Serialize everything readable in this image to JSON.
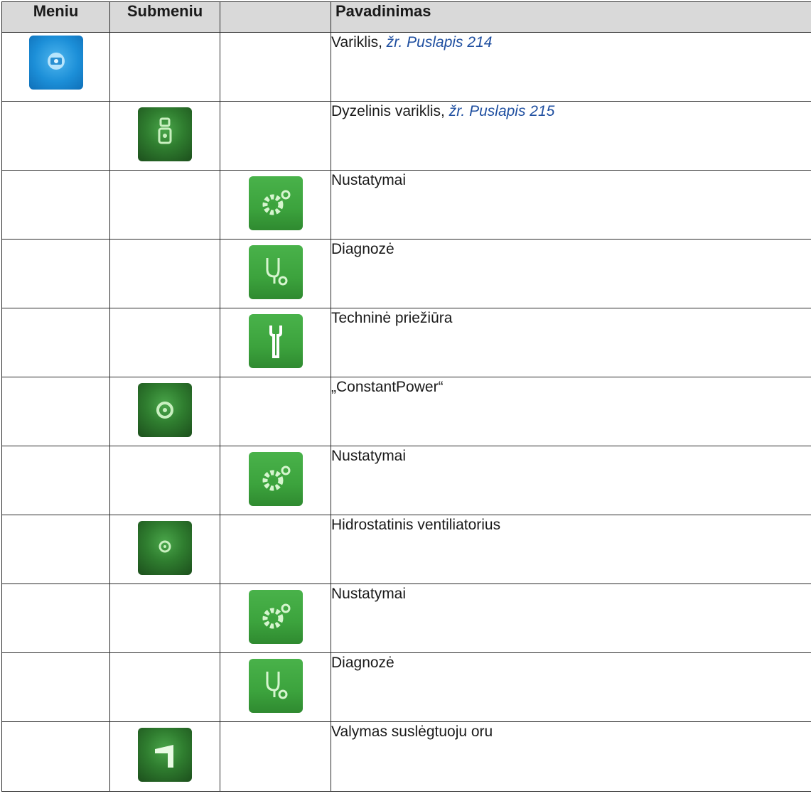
{
  "headers": {
    "menu": "Meniu",
    "submenu": "Submeniu",
    "extra": "",
    "name": "Pavadinimas"
  },
  "rows": [
    {
      "level": 1,
      "icon": "engine-menu-icon",
      "label": "Variklis, ",
      "link": "žr. Puslapis 214"
    },
    {
      "level": 2,
      "icon": "diesel-engine-icon",
      "label": "Dyzelinis variklis, ",
      "link": "žr. Puslapis 215"
    },
    {
      "level": 3,
      "icon": "settings-gear-icon",
      "label": "Nustatymai"
    },
    {
      "level": 3,
      "icon": "diagnosis-icon",
      "label": "Diagnozė"
    },
    {
      "level": 3,
      "icon": "maintenance-wrench-icon",
      "label": "Techninė priežiūra"
    },
    {
      "level": 2,
      "icon": "constant-power-icon",
      "label": "„ConstantPower“"
    },
    {
      "level": 3,
      "icon": "settings-gear-icon",
      "label": "Nustatymai"
    },
    {
      "level": 2,
      "icon": "hydrostatic-fan-icon",
      "label": "Hidrostatinis ventiliatorius"
    },
    {
      "level": 3,
      "icon": "settings-gear-icon",
      "label": "Nustatymai"
    },
    {
      "level": 3,
      "icon": "diagnosis-icon",
      "label": "Diagnozė"
    },
    {
      "level": 2,
      "icon": "compressed-air-cleaning-icon",
      "label": "Valymas suslėgtuoju oru"
    }
  ]
}
